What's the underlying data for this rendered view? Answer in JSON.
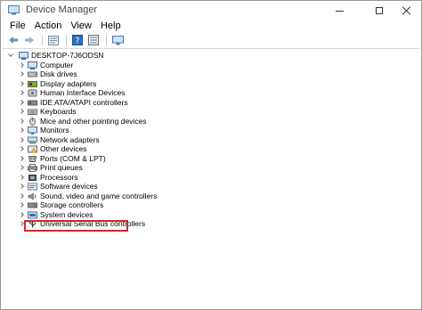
{
  "window": {
    "title": "Device Manager"
  },
  "menu": [
    {
      "label": "File"
    },
    {
      "label": "Action"
    },
    {
      "label": "View"
    },
    {
      "label": "Help"
    }
  ],
  "toolbar": [
    {
      "icon": "back-arrow-icon"
    },
    {
      "icon": "forward-arrow-icon"
    },
    {
      "icon": "properties-sheet-icon"
    },
    {
      "icon": "help-icon"
    },
    {
      "icon": "device-list-icon"
    },
    {
      "icon": "monitor-icon"
    }
  ],
  "tree": {
    "root": {
      "label": "DESKTOP-7J6ODSN",
      "expanded": true
    },
    "items": [
      {
        "label": "Computer",
        "icon": "computer-icon"
      },
      {
        "label": "Disk drives",
        "icon": "disk-drive-icon"
      },
      {
        "label": "Display adapters",
        "icon": "display-adapter-icon"
      },
      {
        "label": "Human Interface Devices",
        "icon": "hid-icon"
      },
      {
        "label": "IDE ATA/ATAPI controllers",
        "icon": "ide-controller-icon"
      },
      {
        "label": "Keyboards",
        "icon": "keyboard-icon"
      },
      {
        "label": "Mice and other pointing devices",
        "icon": "mouse-icon"
      },
      {
        "label": "Monitors",
        "icon": "monitor-icon"
      },
      {
        "label": "Network adapters",
        "icon": "network-adapter-icon"
      },
      {
        "label": "Other devices",
        "icon": "other-device-icon"
      },
      {
        "label": "Ports (COM & LPT)",
        "icon": "port-icon"
      },
      {
        "label": "Print queues",
        "icon": "printer-icon"
      },
      {
        "label": "Processors",
        "icon": "processor-icon"
      },
      {
        "label": "Software devices",
        "icon": "software-device-icon"
      },
      {
        "label": "Sound, video and game controllers",
        "icon": "sound-icon"
      },
      {
        "label": "Storage controllers",
        "icon": "storage-controller-icon"
      },
      {
        "label": "System devices",
        "icon": "system-device-icon"
      },
      {
        "label": "Universal Serial Bus controllers",
        "icon": "usb-icon",
        "highlighted": true
      }
    ]
  },
  "colors": {
    "highlight_border": "#d4262b"
  }
}
